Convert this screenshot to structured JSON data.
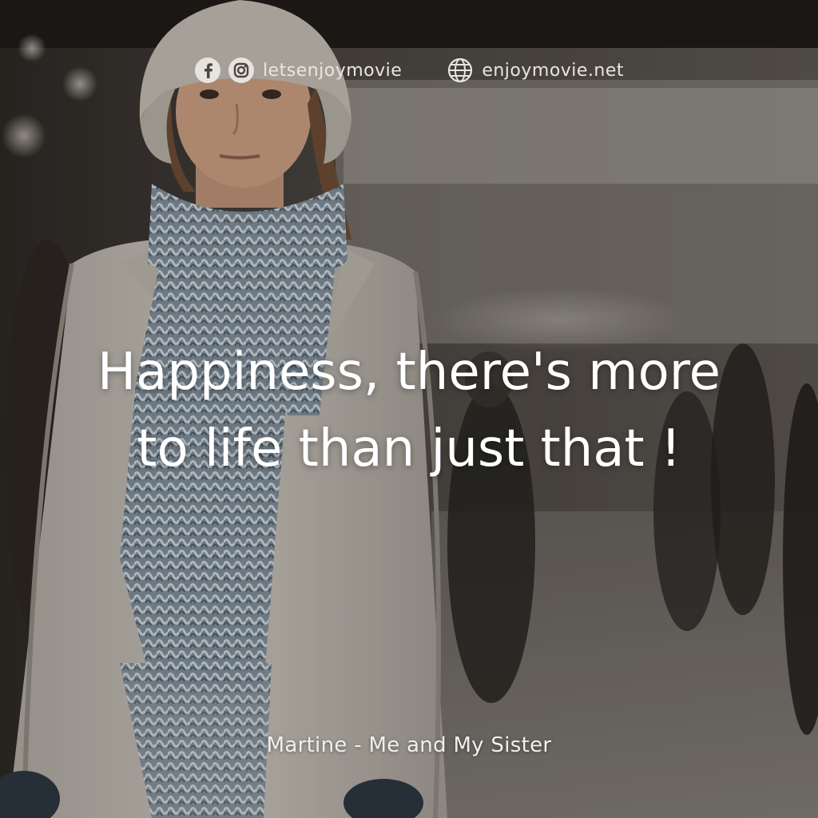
{
  "header": {
    "social_icons": [
      "facebook-icon",
      "instagram-icon"
    ],
    "handle": "letsenjoymovie",
    "site_icon": "globe-icon",
    "website": "enjoymovie.net"
  },
  "quote": {
    "line1": "Happiness, there's more",
    "line2": "to life than just that !"
  },
  "credit": "Martine - Me and My Sister",
  "colors": {
    "text": "#ffffff",
    "icon_fill": "#e7e4e0"
  }
}
